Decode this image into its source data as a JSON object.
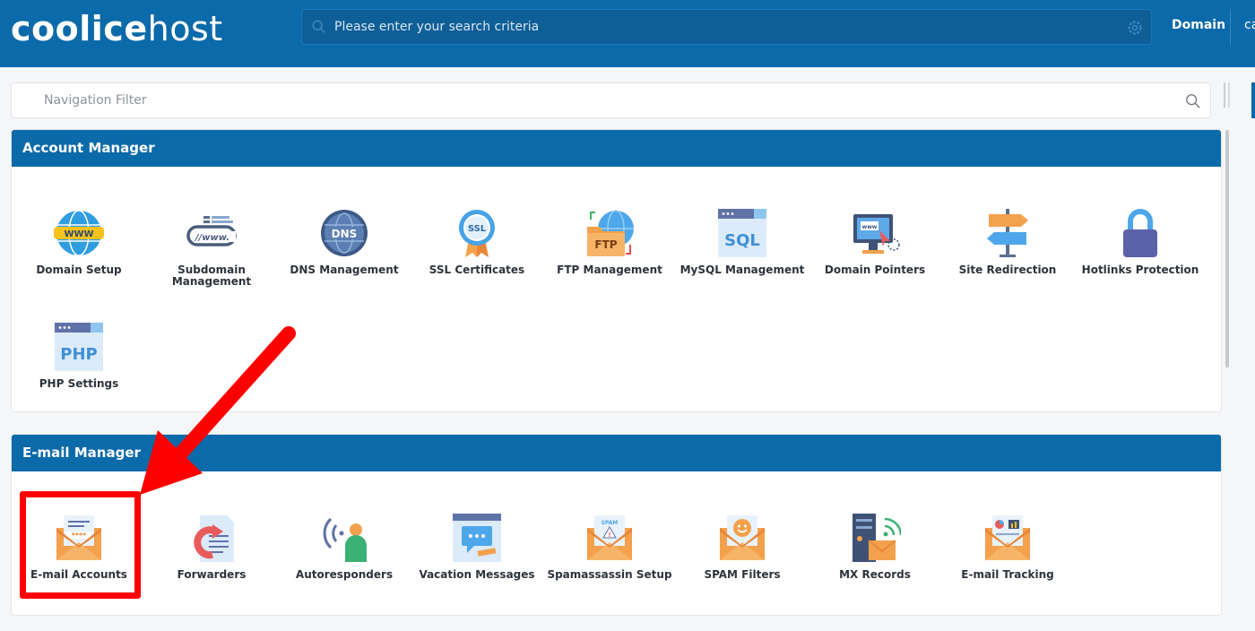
{
  "header": {
    "logo_bold": "coolic",
    "logo_mark": "e",
    "logo_light": "host",
    "search_placeholder": "Please enter your search criteria",
    "domain_label": "Domain",
    "user_partial": "ca"
  },
  "nav_filter": {
    "placeholder": "Navigation Filter"
  },
  "account_manager": {
    "title": "Account Manager",
    "items": [
      {
        "label": "Domain Setup",
        "icon": "globe-www-icon"
      },
      {
        "label": "Subdomain Management",
        "icon": "www-link-icon"
      },
      {
        "label": "DNS Management",
        "icon": "dns-globe-icon"
      },
      {
        "label": "SSL Certificates",
        "icon": "ssl-badge-icon"
      },
      {
        "label": "FTP Management",
        "icon": "ftp-folder-icon"
      },
      {
        "label": "MySQL Management",
        "icon": "sql-window-icon"
      },
      {
        "label": "Domain Pointers",
        "icon": "monitor-pointer-icon"
      },
      {
        "label": "Site Redirection",
        "icon": "signpost-icon"
      },
      {
        "label": "Hotlinks Protection",
        "icon": "padlock-icon"
      },
      {
        "label": "PHP Settings",
        "icon": "php-window-icon"
      }
    ]
  },
  "email_manager": {
    "title": "E-mail Manager",
    "items": [
      {
        "label": "E-mail Accounts",
        "icon": "envelope-password-icon"
      },
      {
        "label": "Forwarders",
        "icon": "forward-document-icon"
      },
      {
        "label": "Autoresponders",
        "icon": "person-signal-icon"
      },
      {
        "label": "Vacation Messages",
        "icon": "chat-window-icon"
      },
      {
        "label": "Spamassassin Setup",
        "icon": "spam-envelope-icon"
      },
      {
        "label": "SPAM Filters",
        "icon": "smiley-envelope-icon"
      },
      {
        "label": "MX Records",
        "icon": "server-envelope-icon"
      },
      {
        "label": "E-mail Tracking",
        "icon": "chart-envelope-icon"
      }
    ]
  },
  "colors": {
    "header": "#0b6aa9",
    "accent_red": "#ff0000"
  }
}
